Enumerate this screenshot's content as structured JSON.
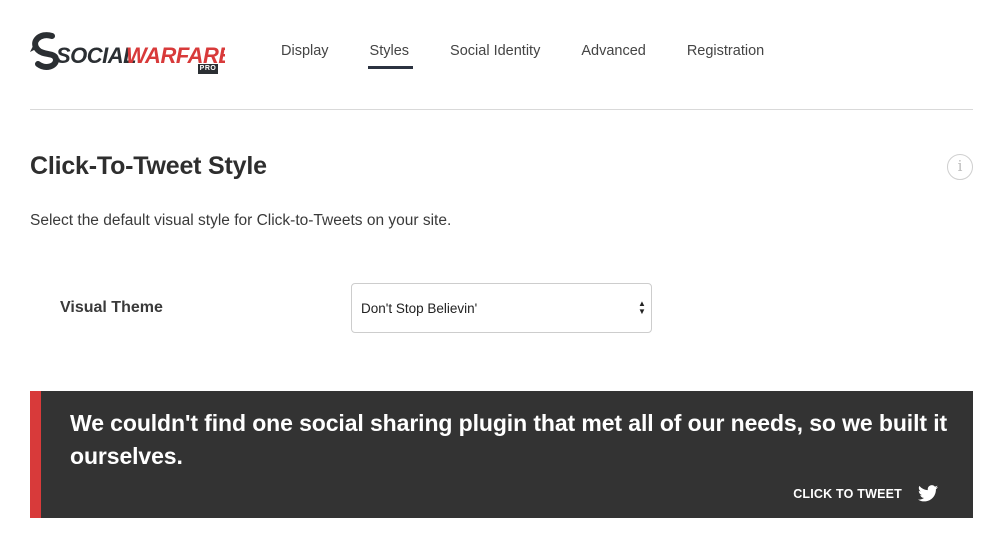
{
  "brand": {
    "name_part1": "SOCIAL",
    "name_part2": "WARFARE",
    "badge": "PRO",
    "accent_color": "#d83a3a",
    "dark_color": "#2b2f33"
  },
  "nav": {
    "items": [
      {
        "label": "Display",
        "active": false
      },
      {
        "label": "Styles",
        "active": true
      },
      {
        "label": "Social Identity",
        "active": false
      },
      {
        "label": "Advanced",
        "active": false
      },
      {
        "label": "Registration",
        "active": false
      }
    ]
  },
  "section": {
    "title": "Click-To-Tweet Style",
    "info_icon_glyph": "i",
    "description": "Select the default visual style for Click-to-Tweets on your site."
  },
  "visual_theme": {
    "label": "Visual Theme",
    "selected": "Don't Stop Believin'"
  },
  "preview": {
    "quote": "We couldn't find one social sharing plugin that met all of our needs, so we built it ourselves.",
    "action_label": "CLICK TO TWEET",
    "action_icon": "twitter-icon",
    "background_color": "#333333",
    "border_color": "#d83a3a"
  }
}
